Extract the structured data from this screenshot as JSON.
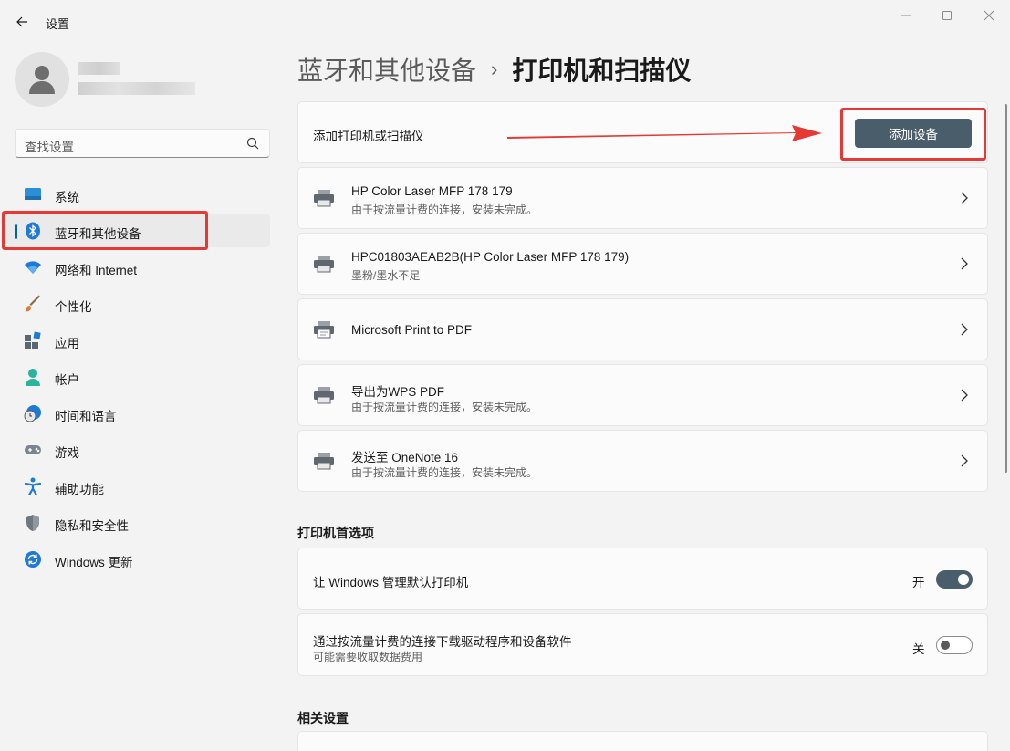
{
  "window": {
    "title": "设置"
  },
  "profile": {
    "name_hidden": true
  },
  "search": {
    "placeholder": "查找设置"
  },
  "nav": {
    "items": [
      {
        "label": "系统",
        "icon": "system-icon"
      },
      {
        "label": "蓝牙和其他设备",
        "icon": "bluetooth-icon",
        "active": true
      },
      {
        "label": "网络和 Internet",
        "icon": "wifi-icon"
      },
      {
        "label": "个性化",
        "icon": "brush-icon"
      },
      {
        "label": "应用",
        "icon": "apps-icon"
      },
      {
        "label": "帐户",
        "icon": "account-icon"
      },
      {
        "label": "时间和语言",
        "icon": "globe-clock-icon"
      },
      {
        "label": "游戏",
        "icon": "gamepad-icon"
      },
      {
        "label": "辅助功能",
        "icon": "accessibility-icon"
      },
      {
        "label": "隐私和安全性",
        "icon": "shield-icon"
      },
      {
        "label": "Windows 更新",
        "icon": "update-icon"
      }
    ]
  },
  "breadcrumb": {
    "parent": "蓝牙和其他设备",
    "separator": "›",
    "current": "打印机和扫描仪"
  },
  "add_section": {
    "label": "添加打印机或扫描仪",
    "button": "添加设备"
  },
  "printers": [
    {
      "name": "HP Color Laser MFP 178 179",
      "status": "由于按流量计费的连接，安装未完成。"
    },
    {
      "name": "HPC01803AEAB2B(HP Color Laser MFP 178 179)",
      "status": "墨粉/墨水不足"
    },
    {
      "name": "Microsoft Print to PDF",
      "status": ""
    },
    {
      "name": "导出为WPS PDF",
      "status": "由于按流量计费的连接，安装未完成。"
    },
    {
      "name": "发送至 OneNote 16",
      "status": "由于按流量计费的连接，安装未完成。"
    }
  ],
  "preferences": {
    "title": "打印机首选项",
    "items": [
      {
        "label": "让 Windows 管理默认打印机",
        "sub": "",
        "state_label": "开",
        "on": true
      },
      {
        "label": "通过按流量计费的连接下载驱动程序和设备软件",
        "sub": "可能需要收取数据费用",
        "state_label": "关",
        "on": false
      }
    ]
  },
  "related": {
    "title": "相关设置"
  },
  "colors": {
    "accent": "#005fb8",
    "button": "#4a5d6b",
    "annotation": "#e53935"
  }
}
